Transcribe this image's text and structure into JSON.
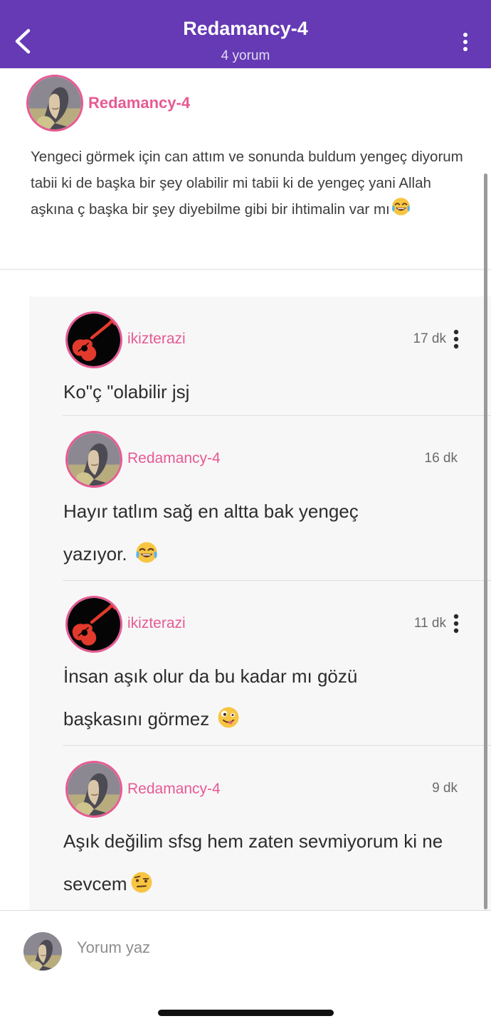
{
  "header": {
    "title": "Redamancy-4",
    "subtitle": "4 yorum",
    "background": "#653ab4",
    "back_icon": "chevron-left-icon",
    "more_icon": "more-vertical-icon"
  },
  "post": {
    "author": "Redamancy-4",
    "avatar_icon": "user-photo-avatar",
    "text": "Yengeci görmek için can attım ve sonunda buldum yengeç diyorum tabii ki de başka bir şey olabilir mi tabii ki de yengeç yani Allah aşkına ç başka bir şey diyebilme gibi bir ihtimalin var mı",
    "emoji": "tears-of-joy-emoji"
  },
  "comments": [
    {
      "author": "ikizterazi",
      "time": "17 dk",
      "text": "Ko\"ç \"olabilir jsj",
      "has_menu": true,
      "avatar_icon": "guitar-avatar"
    },
    {
      "author": "Redamancy-4",
      "time": "16 dk",
      "text": "Hayır tatlım sağ en altta bak yengeç yazıyor.",
      "emoji": "tears-of-joy-emoji",
      "has_menu": false,
      "avatar_icon": "user-photo-avatar"
    },
    {
      "author": "ikizterazi",
      "time": "11 dk",
      "text": "İnsan aşık olur da bu kadar mı gözü başkasını görmez",
      "emoji": "zany-face-emoji",
      "has_menu": true,
      "avatar_icon": "guitar-avatar"
    },
    {
      "author": "Redamancy-4",
      "time": "9 dk",
      "text": "Aşık değilim sfsg hem zaten sevmiyorum ki ne sevcem",
      "emoji": "raised-eyebrow-emoji",
      "has_menu": false,
      "avatar_icon": "user-photo-avatar"
    }
  ],
  "composer": {
    "placeholder": "Yorum yaz",
    "avatar_icon": "user-photo-avatar"
  },
  "colors": {
    "accent": "#653ab4",
    "username": "#e75a93",
    "thread_bg": "#f7f7f7"
  }
}
